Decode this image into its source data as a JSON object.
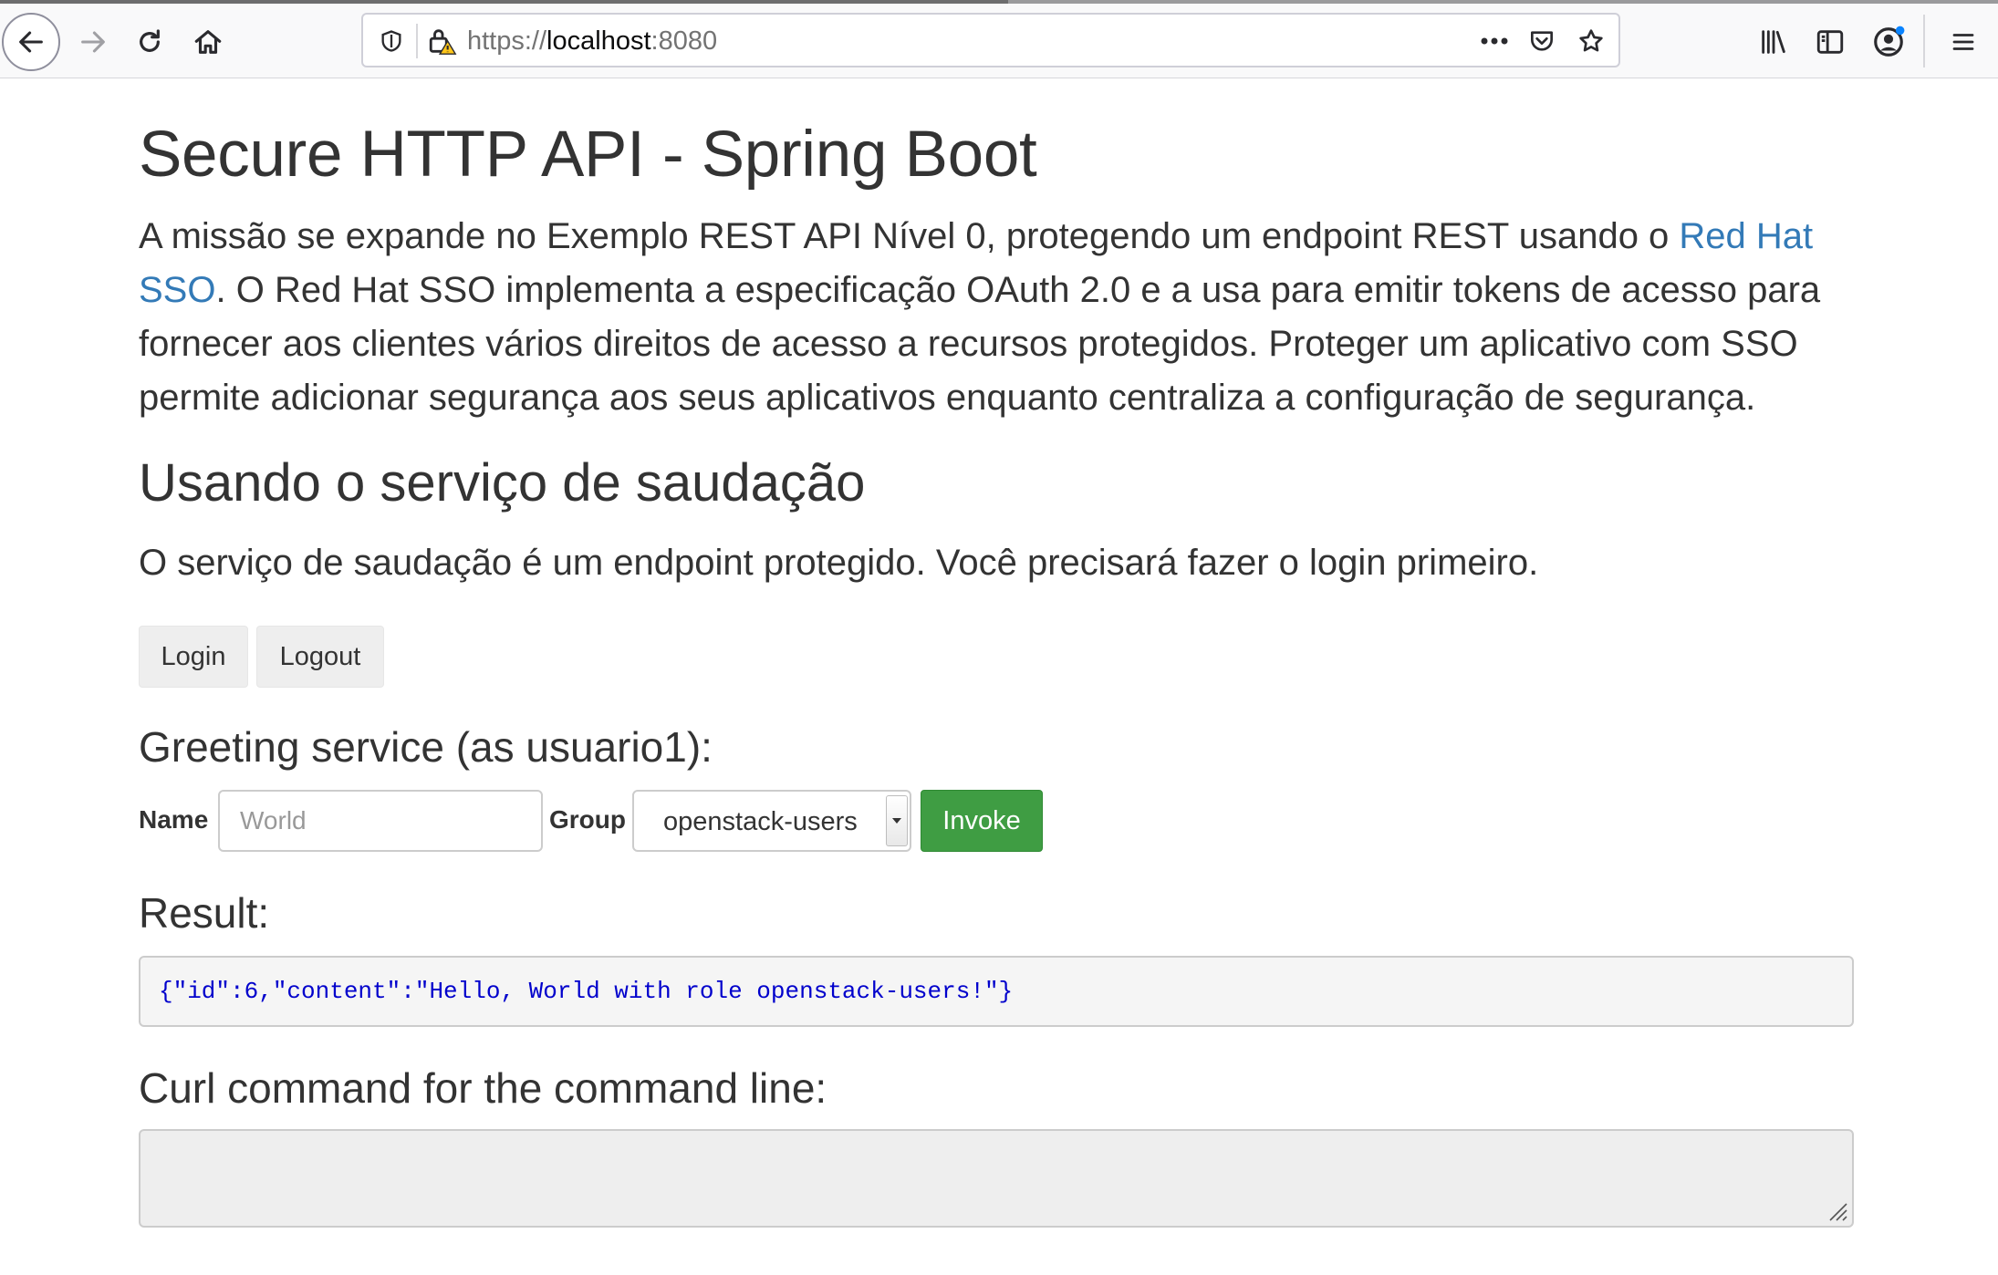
{
  "browser": {
    "url_scheme": "https://",
    "url_host": "localhost",
    "url_port": ":8080"
  },
  "page": {
    "title": "Secure HTTP API - Spring Boot",
    "intro_part1": "A missão se expande no Exemplo REST API Nível 0, protegendo um endpoint REST usando o ",
    "intro_link": "Red Hat SSO",
    "intro_part2": ". O Red Hat SSO implementa a especificação OAuth 2.0 e a usa para emitir tokens de acesso para fornecer aos clientes vários direitos de acesso a recursos protegidos. Proteger um aplicativo com SSO permite adicionar segurança aos seus aplicativos enquanto centraliza a configuração de segurança.",
    "section_title": "Usando o serviço de saudação",
    "section_lead": "O serviço de saudação é um endpoint protegido. Você precisará fazer o login primeiro."
  },
  "auth": {
    "login_label": "Login",
    "logout_label": "Logout"
  },
  "greeting": {
    "heading": "Greeting service (as usuario1):",
    "name_label": "Name",
    "name_placeholder": "World",
    "name_value": "",
    "group_label": "Group",
    "group_value": "openstack-users",
    "invoke_label": "Invoke"
  },
  "result": {
    "heading": "Result:",
    "value": "{\"id\":6,\"content\":\"Hello, World with role openstack-users!\"}"
  },
  "curl": {
    "heading": "Curl command for the command line:",
    "value": ""
  },
  "colors": {
    "link": "#337ab7",
    "invoke": "#3f9d43",
    "result_text": "#0000cc"
  }
}
